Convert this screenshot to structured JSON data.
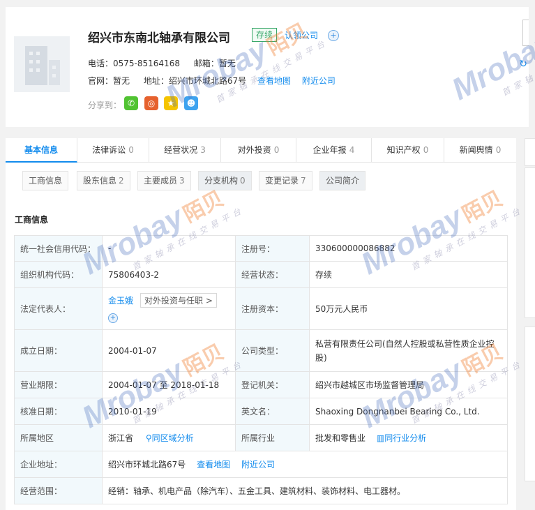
{
  "header": {
    "company_name": "绍兴市东南北轴承有限公司",
    "status_tag": "存续",
    "claim_label": "认领公司",
    "phone_label": "电话：",
    "phone": "0575-85164168",
    "email_label": "邮箱：",
    "email": "暂无",
    "website_label": "官网：",
    "website": "暂无",
    "address_label": "地址：",
    "address": "绍兴市环城北路67号",
    "map_link": "查看地图",
    "nearby_link": "附近公司",
    "share_label": "分享到：",
    "share_icons": [
      "wechat-icon",
      "weibo-icon",
      "qzone-icon",
      "qq-icon"
    ],
    "colors": {
      "wechat": "#51c332",
      "weibo": "#e6612e",
      "qzone": "#f5c400",
      "qq": "#3ea3ef"
    }
  },
  "tabs": [
    {
      "label": "基本信息",
      "count": ""
    },
    {
      "label": "法律诉讼",
      "count": "0"
    },
    {
      "label": "经营状况",
      "count": "3"
    },
    {
      "label": "对外投资",
      "count": "0"
    },
    {
      "label": "企业年报",
      "count": "4"
    },
    {
      "label": "知识产权",
      "count": "0"
    },
    {
      "label": "新闻舆情",
      "count": "0"
    }
  ],
  "subtabs": [
    {
      "label": "工商信息",
      "count": ""
    },
    {
      "label": "股东信息",
      "count": "2"
    },
    {
      "label": "主要成员",
      "count": "3"
    },
    {
      "label": "分支机构",
      "count": "0"
    },
    {
      "label": "变更记录",
      "count": "7"
    },
    {
      "label": "公司简介",
      "count": ""
    }
  ],
  "section_title": "工商信息",
  "table": {
    "credit_code_label": "统一社会信用代码：",
    "credit_code_value": "-",
    "reg_no_label": "注册号：",
    "reg_no_value": "330600000086882",
    "org_code_label": "组织机构代码：",
    "org_code_value": "75806403-2",
    "status_label": "经营状态：",
    "status_value": "存续",
    "legal_rep_label": "法定代表人：",
    "legal_rep_value": "金玉娥",
    "legal_rep_pill": "对外投资与任职 >",
    "capital_label": "注册资本：",
    "capital_value": "50万元人民币",
    "founded_label": "成立日期：",
    "founded_value": "2004-01-07",
    "type_label": "公司类型：",
    "type_value": "私营有限责任公司(自然人控股或私营性质企业控股)",
    "term_label": "营业期限：",
    "term_value": "2004-01-07 至 2018-01-18",
    "authority_label": "登记机关：",
    "authority_value": "绍兴市越城区市场监督管理局",
    "approved_label": "核准日期：",
    "approved_value": "2010-01-19",
    "english_label": "英文名：",
    "english_value": "Shaoxing Dongnanbei Bearing Co., Ltd.",
    "region_label": "所属地区",
    "region_value": "浙江省",
    "region_link": "同区域分析",
    "industry_label": "所属行业",
    "industry_value": "批发和零售业",
    "industry_link": "同行业分析",
    "address_label": "企业地址：",
    "address_value": "绍兴市环城北路67号",
    "address_map": "查看地图",
    "address_nearby": "附近公司",
    "scope_label": "经营范围：",
    "scope_value": "经销：轴承、机电产品（除汽车）、五金工具、建筑材料、装饰材料、电工器材。"
  },
  "watermark": {
    "brand": "Mrobay",
    "brand_cn": "陌贝",
    "tagline": "首家轴承在线交易平台"
  }
}
